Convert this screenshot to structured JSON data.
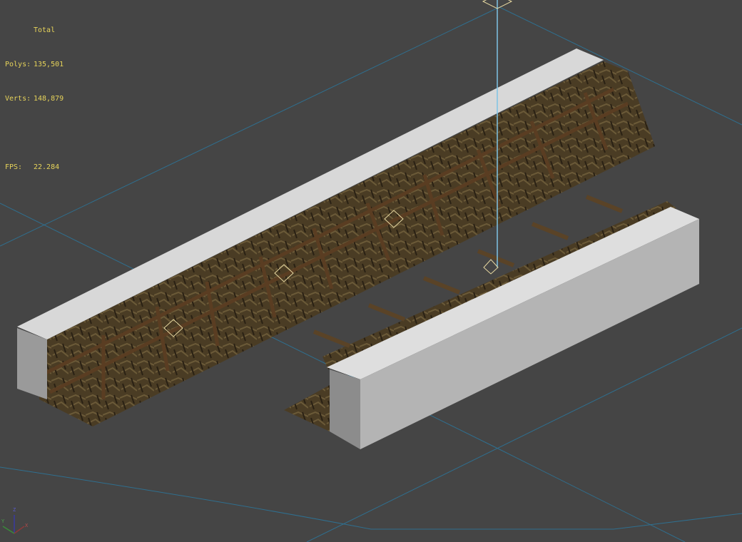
{
  "viewport": {
    "background_color": "#454545",
    "grid_color": "#2f6f8f",
    "stats_color": "#e6d35a",
    "stats": {
      "header": "Total",
      "polys_label": "Polys:",
      "polys_value": "135,501",
      "verts_label": "Verts:",
      "verts_value": "148,879",
      "fps_label": "FPS:",
      "fps_value": "22.284"
    },
    "axis_gizmo": {
      "x": "X",
      "y": "Y",
      "z": "Z"
    }
  }
}
